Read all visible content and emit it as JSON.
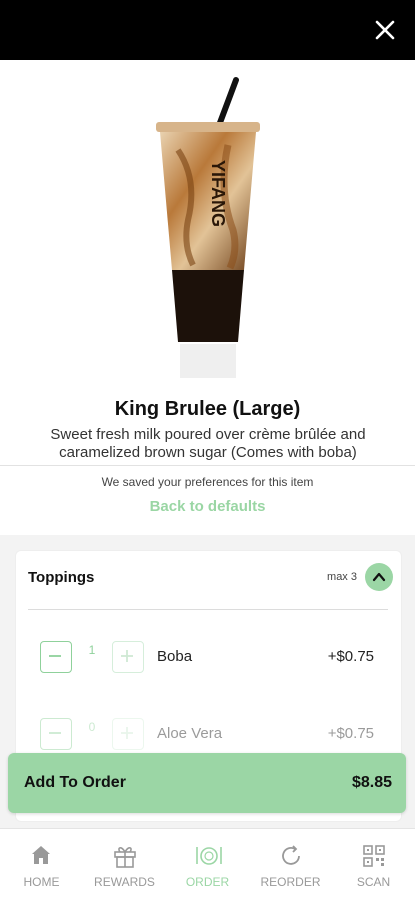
{
  "header": {
    "close_icon": "close-icon"
  },
  "product": {
    "title": "King Brulee (Large)",
    "description": "Sweet fresh milk poured over crème brûlée and caramelized brown sugar (Comes with boba)",
    "cup_text": "YIFANG",
    "image_icon": "boba-drink-image"
  },
  "preferences": {
    "note": "We saved your preferences for this item",
    "reset_label": "Back to defaults"
  },
  "toppings": {
    "title": "Toppings",
    "max_label": "max 3",
    "items": [
      {
        "name": "Boba",
        "qty": "1",
        "price": "+$0.75"
      },
      {
        "name": "Aloe Vera",
        "qty": "0",
        "price": "+$0.75"
      }
    ]
  },
  "cart": {
    "add_label": "Add To Order",
    "total": "$8.85"
  },
  "nav": {
    "items": [
      {
        "label": "HOME",
        "icon": "home-icon"
      },
      {
        "label": "REWARDS",
        "icon": "gift-icon"
      },
      {
        "label": "ORDER",
        "icon": "order-icon",
        "active": true
      },
      {
        "label": "REORDER",
        "icon": "reorder-icon"
      },
      {
        "label": "SCAN",
        "icon": "qr-scan-icon"
      }
    ]
  },
  "colors": {
    "accent": "#9bd6a5",
    "header": "#000000"
  }
}
